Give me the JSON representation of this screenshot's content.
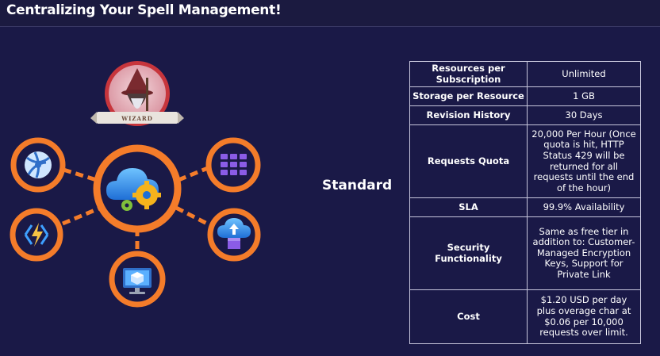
{
  "header": {
    "title": "Centralizing Your Spell Management!"
  },
  "diagram": {
    "badge_text": "WIZARD",
    "accent_color": "#f47c2a",
    "center_icon": "cloud-gears-icon",
    "satellites": [
      {
        "name": "globe-network-icon"
      },
      {
        "name": "cube-grid-icon"
      },
      {
        "name": "lightning-icon"
      },
      {
        "name": "cloud-upload-icon"
      },
      {
        "name": "monitor-cube-icon"
      }
    ]
  },
  "tier": {
    "label": "Standard"
  },
  "table": {
    "rows": [
      {
        "key": "Resources per Subscription",
        "value": "Unlimited"
      },
      {
        "key": "Storage per Resource",
        "value": "1 GB"
      },
      {
        "key": "Revision History",
        "value": "30 Days"
      },
      {
        "key": "Requests Quota",
        "value": "20,000 Per Hour (Once quota is hit, HTTP Status 429 will be returned for all requests until the end of the hour)"
      },
      {
        "key": "SLA",
        "value": "99.9% Availability"
      },
      {
        "key": "Security Functionality",
        "value": "Same as free tier in addition to: Customer-Managed Encryption Keys, Support for Private Link"
      },
      {
        "key": "Cost",
        "value": "$1.20 USD per day plus overage char at $0.06 per 10,000 requests over limit."
      }
    ]
  }
}
